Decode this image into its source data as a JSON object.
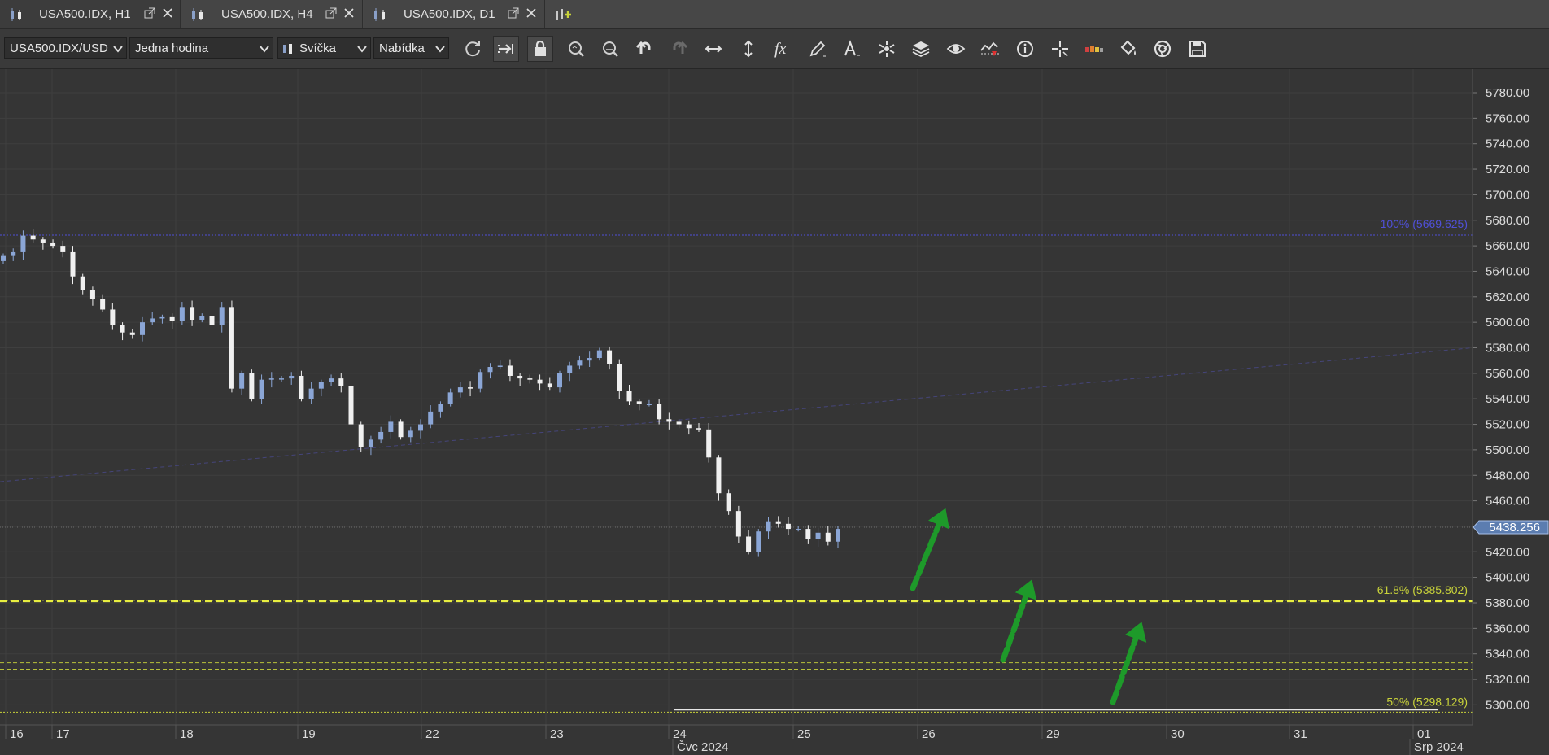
{
  "tabs": [
    {
      "label": "USA500.IDX, H1",
      "active": true
    },
    {
      "label": "USA500.IDX, H4",
      "active": false
    },
    {
      "label": "USA500.IDX, D1",
      "active": false
    }
  ],
  "toolbar": {
    "instrument": "USA500.IDX/USD",
    "period": "Jedna hodina",
    "chart_type": "Svíčka",
    "price_side": "Nabídka",
    "icons": [
      "refresh-icon",
      "shift-chart-icon",
      "lock-icon",
      "zoom-in-icon",
      "zoom-out-icon",
      "undo-icon",
      "redo-icon",
      "horizontal-scale-icon",
      "vertical-scale-icon",
      "indicators-fx-icon",
      "pencil-draw-icon",
      "text-tool-icon",
      "objects-star-icon",
      "layers-icon",
      "eye-icon",
      "alerts-icon",
      "info-icon",
      "crosshair-icon",
      "color-scale-icon",
      "paint-bucket-icon",
      "themes-icon",
      "save-icon"
    ]
  },
  "chart_data": {
    "type": "candlestick",
    "symbol": "USA500.IDX",
    "timeframe": "H1",
    "ylim": [
      5290,
      5790
    ],
    "y_ticks": [
      "5780.00",
      "5760.00",
      "5740.00",
      "5720.00",
      "5700.00",
      "5680.00",
      "5660.00",
      "5640.00",
      "5620.00",
      "5600.00",
      "5580.00",
      "5560.00",
      "5540.00",
      "5520.00",
      "5500.00",
      "5480.00",
      "5460.00",
      "5440.00",
      "5420.00",
      "5400.00",
      "5380.00",
      "5360.00",
      "5340.00",
      "5320.00",
      "5300.00"
    ],
    "x_ticks": [
      "16",
      "17",
      "18",
      "19",
      "22",
      "23",
      "24",
      "25",
      "26",
      "29",
      "30",
      "31",
      "01"
    ],
    "x_period_labels": [
      "Čvc 2024",
      "Srp 2024"
    ],
    "current_price": "5438.256",
    "fib_levels": [
      {
        "label": "100% (5669.625)",
        "value": 5669.625,
        "color": "#5050d8"
      },
      {
        "label": "61.8% (5385.802)",
        "value": 5385.802,
        "color": "#c8d23a"
      },
      {
        "label": "50% (5298.129)",
        "value": 5298.129,
        "color": "#c8d23a"
      }
    ],
    "support_dashed": [
      5382.0
    ],
    "minor_lines": [
      5333.0,
      5328.0
    ],
    "white_line": 5298.0,
    "trendline": {
      "from": [
        "2024-07-16",
        5475
      ],
      "to": [
        "2024-08-01",
        5580
      ]
    },
    "series": [
      {
        "name": "close",
        "values": [
          5652,
          5655,
          5668,
          5665,
          5662,
          5660,
          5655,
          5636,
          5625,
          5618,
          5610,
          5598,
          5592,
          5590,
          5600,
          5603,
          5604,
          5601,
          5612,
          5602,
          5605,
          5598,
          5612,
          5548,
          5560,
          5540,
          5555,
          5556,
          5556,
          5558,
          5540,
          5548,
          5553,
          5556,
          5550,
          5520,
          5502,
          5508,
          5514,
          5522,
          5510,
          5515,
          5520,
          5530,
          5536,
          5545,
          5549,
          5548,
          5561,
          5565,
          5566,
          5558,
          5556,
          5555,
          5552,
          5549,
          5560,
          5566,
          5570,
          5572,
          5578,
          5567,
          5546,
          5538,
          5536,
          5536,
          5524,
          5522,
          5520,
          5517,
          5516,
          5494,
          5466,
          5452,
          5432,
          5420,
          5436,
          5444,
          5442,
          5438,
          5438,
          5430,
          5435,
          5428,
          5438
        ]
      }
    ],
    "annotation_arrows": 3
  }
}
